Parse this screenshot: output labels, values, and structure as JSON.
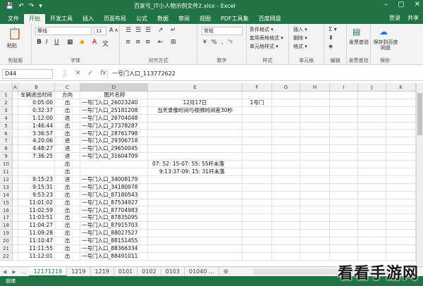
{
  "window": {
    "title": "百家号_IT小人物示例文件2.xlsx - Excel",
    "controls": [
      "–",
      "▢",
      "✕"
    ]
  },
  "qat": [
    "💾",
    "↶",
    "↷",
    "▾"
  ],
  "tabs": [
    "文件",
    "开始",
    "开发工具",
    "插入",
    "页面布局",
    "公式",
    "数据",
    "审阅",
    "视图",
    "PDF工具集",
    "百度网盘"
  ],
  "tabs_right": [
    "登录",
    "共享"
  ],
  "ribbon": {
    "clipboard": {
      "paste": "粘贴",
      "label": "剪贴板"
    },
    "font": {
      "name": "等线",
      "size": "11",
      "grow": "A",
      "shrink": "A",
      "bold": "B",
      "italic": "I",
      "underline": "U",
      "color": "A",
      "label": "字体"
    },
    "alignment": {
      "label": "对齐方式"
    },
    "number": {
      "format": "常规",
      "percent": "%",
      "comma": "‚",
      "label": "数字"
    },
    "styles": {
      "conditional": "条件格式 ▾",
      "table": "套用表格格式 ▾",
      "cell": "单元格样式 ▾",
      "label": "样式"
    },
    "cells": {
      "insert": "插入 ▾",
      "delete": "删除 ▾",
      "format": "格式 ▾",
      "label": "单元格"
    },
    "editing": {
      "sum": "Σ ▾",
      "label": "编辑"
    },
    "invoice": {
      "btn": "发票查验",
      "label": "发票查验"
    },
    "save": {
      "btn": "保存到百度网盘",
      "label": "保存"
    }
  },
  "formula_bar": {
    "namebox": "D44",
    "fx": [
      "⋮",
      "✕",
      "✓",
      "fx"
    ],
    "content": "一号门入口_113772622"
  },
  "columns": [
    "A",
    "B",
    "C",
    "D",
    "E",
    "F",
    "G",
    "H",
    "I",
    "J",
    "K"
  ],
  "rows": [
    {
      "n": "1",
      "b": "车辆进出时间",
      "c": "方向",
      "d": "图片名称",
      "e": "",
      "f": ""
    },
    {
      "n": "2",
      "b": "0:05:00",
      "c": "出",
      "d": "一号门入口_26023240",
      "e": "12月17日",
      "f": "1号门"
    },
    {
      "n": "3",
      "b": "0:32:37",
      "c": "出",
      "d": "一号门入口_25181208",
      "e": "当天录像时间与视频时间差30秒",
      "f": ""
    },
    {
      "n": "4",
      "b": "1:12:00",
      "c": "进",
      "d": "一号门入口_26704048",
      "e": "",
      "f": ""
    },
    {
      "n": "5",
      "b": "1:46:44",
      "c": "出",
      "d": "一号门入口_27378287",
      "e": "",
      "f": ""
    },
    {
      "n": "6",
      "b": "3:36:57",
      "c": "出",
      "d": "一号门入口_28761798",
      "e": "",
      "f": ""
    },
    {
      "n": "7",
      "b": "4:20:06",
      "c": "进",
      "d": "一号门入口_29306718",
      "e": "",
      "f": ""
    },
    {
      "n": "8",
      "b": "4:48:27",
      "c": "进",
      "d": "一号门入口_29650045",
      "e": "",
      "f": ""
    },
    {
      "n": "9",
      "b": "7:36:25",
      "c": "进",
      "d": "一号门入口_31604709",
      "e": "",
      "f": ""
    },
    {
      "n": "10",
      "b": "",
      "c": "出",
      "d": "",
      "e": "07: 52: 15-07: 55: 55杆未落",
      "f": ""
    },
    {
      "n": "11",
      "b": "",
      "c": "出",
      "d": "",
      "e": "9:13:37-09: 15: 31杆未落",
      "f": ""
    },
    {
      "n": "12",
      "b": "9:15:23",
      "c": "进",
      "d": "一号门入口_34008179",
      "e": "",
      "f": ""
    },
    {
      "n": "13",
      "b": "9:15:31",
      "c": "出",
      "d": "一号门入口_34180978",
      "e": "",
      "f": ""
    },
    {
      "n": "14",
      "b": "9:53:23",
      "c": "出",
      "d": "一号门入口_87180543",
      "e": "",
      "f": ""
    },
    {
      "n": "15",
      "b": "11:01:02",
      "c": "出",
      "d": "一号门入口_87534927",
      "e": "",
      "f": ""
    },
    {
      "n": "16",
      "b": "11:02:59",
      "c": "出",
      "d": "一号门入口_87704983",
      "e": "",
      "f": ""
    },
    {
      "n": "17",
      "b": "11:03:51",
      "c": "出",
      "d": "一号门入口_87835095",
      "e": "",
      "f": ""
    },
    {
      "n": "18",
      "b": "11:04:27",
      "c": "出",
      "d": "一号门入口_87915703",
      "e": "",
      "f": ""
    },
    {
      "n": "19",
      "b": "11:09:28",
      "c": "出",
      "d": "一号门入口_88027527",
      "e": "",
      "f": ""
    },
    {
      "n": "20",
      "b": "11:10:47",
      "c": "出",
      "d": "一号门入口_88151455",
      "e": "",
      "f": ""
    },
    {
      "n": "21",
      "b": "11:11:55",
      "c": "出",
      "d": "一号门入口_88366334",
      "e": "",
      "f": ""
    },
    {
      "n": "22",
      "b": "11:12:01",
      "c": "出",
      "d": "一号门入口_88491011",
      "e": "",
      "f": ""
    }
  ],
  "sheets": [
    "12171218",
    "1219",
    "1219",
    "0101",
    "0102",
    "0103",
    "01040 ..."
  ],
  "sheet_nav": [
    "◀",
    "▶",
    "..."
  ],
  "add_sheet": "⊕",
  "status": "就绪",
  "watermark": "看看手游网",
  "colors": {
    "accent": "#217346"
  }
}
